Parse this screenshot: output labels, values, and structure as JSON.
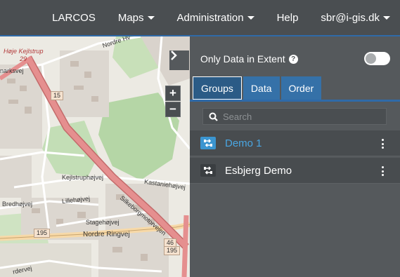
{
  "navbar": {
    "items": [
      {
        "label": "LARCOS",
        "dropdown": false
      },
      {
        "label": "Maps",
        "dropdown": true
      },
      {
        "label": "Administration",
        "dropdown": true
      },
      {
        "label": "Help",
        "dropdown": false
      },
      {
        "label": "sbr@i-gis.dk",
        "dropdown": true
      }
    ]
  },
  "map": {
    "zoom_in": "+",
    "zoom_out": "−",
    "labels": {
      "hoje_kejlstrup": "Høje Kejlstrup",
      "hoje_kejlstrup_num": "29",
      "norre_hv": "Nordre Hv",
      "narksvej": "narksvej",
      "kejlstruphojvej": "Kejlstruphøjvej",
      "kastaniehojvej": "Kastaniehøjvej",
      "bredhojvej": "Bredhøjvej",
      "lillehojvej": "Lillehøjvej",
      "silkeborgmotorvejen": "Silkeborgmotorvejen",
      "stagehojvej": "Stagehøjvej",
      "nordre_ringvej": "Nordre Ringvej",
      "nygaardsvej": "rdervej",
      "route_15": "15",
      "route_195_a": "195",
      "route_46": "46",
      "route_195_b": "195"
    },
    "colors": {
      "motorway": "#e58f8f",
      "forest": "#add19e",
      "residential": "#dcd7d0"
    }
  },
  "panel": {
    "extent_label": "Only Data in Extent",
    "extent_toggle_on": false,
    "tabs": [
      {
        "label": "Groups",
        "active": true
      },
      {
        "label": "Data",
        "active": false
      },
      {
        "label": "Order",
        "active": false
      }
    ],
    "search_placeholder": "Search",
    "items": [
      {
        "label": "Demo 1",
        "active": true
      },
      {
        "label": "Esbjerg Demo",
        "active": false
      }
    ]
  },
  "colors": {
    "navbar_bg": "#4a4e51",
    "panel_bg": "#55595c",
    "accent": "#2f6aa8",
    "active_item": "#4aa6e2"
  }
}
